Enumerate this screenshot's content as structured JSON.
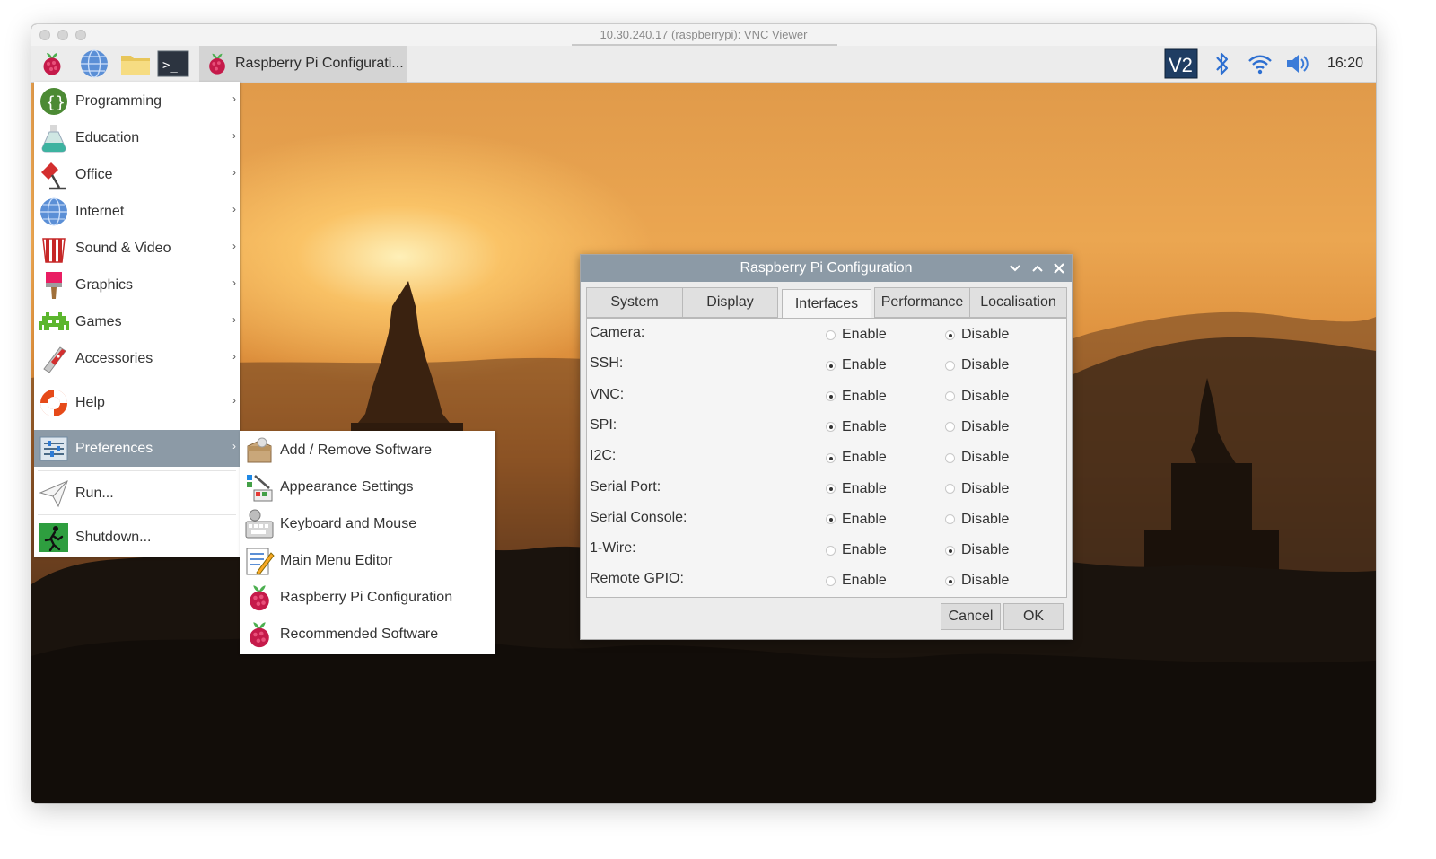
{
  "vnc_window": {
    "title": "10.30.240.17 (raspberrypi): VNC Viewer"
  },
  "taskbar": {
    "launchers": [
      {
        "icon": "raspberry-icon"
      },
      {
        "icon": "globe-icon"
      },
      {
        "icon": "folder-icon"
      },
      {
        "icon": "terminal-icon",
        "text": ">_"
      }
    ],
    "task": {
      "icon": "raspberry-icon",
      "label": "Raspberry Pi Configurati..."
    },
    "tray": {
      "vnc_icon_text": "V2",
      "clock": "16:20"
    }
  },
  "main_menu": {
    "items": [
      {
        "label": "Programming",
        "icon": "programming-icon",
        "submenu": true
      },
      {
        "label": "Education",
        "icon": "education-flask-icon",
        "submenu": true
      },
      {
        "label": "Office",
        "icon": "office-icon",
        "submenu": true
      },
      {
        "label": "Internet",
        "icon": "globe-icon",
        "submenu": true
      },
      {
        "label": "Sound & Video",
        "icon": "popcorn-icon",
        "submenu": true
      },
      {
        "label": "Graphics",
        "icon": "paintbrush-icon",
        "submenu": true
      },
      {
        "label": "Games",
        "icon": "invader-icon",
        "submenu": true
      },
      {
        "label": "Accessories",
        "icon": "knife-icon",
        "submenu": true
      },
      {
        "label": "Help",
        "icon": "lifebuoy-icon",
        "submenu": true
      },
      {
        "label": "Preferences",
        "icon": "sliders-icon",
        "submenu": true,
        "selected": true
      },
      {
        "label": "Run...",
        "icon": "paper-plane-icon",
        "submenu": false
      },
      {
        "label": "Shutdown...",
        "icon": "exit-icon",
        "submenu": false
      }
    ],
    "arrow": "›"
  },
  "preferences_submenu": {
    "items": [
      {
        "label": "Add / Remove Software",
        "icon": "package-icon"
      },
      {
        "label": "Appearance Settings",
        "icon": "appearance-icon"
      },
      {
        "label": "Keyboard and Mouse",
        "icon": "keyboard-icon"
      },
      {
        "label": "Main Menu Editor",
        "icon": "menu-editor-icon"
      },
      {
        "label": "Raspberry Pi Configuration",
        "icon": "raspberry-icon"
      },
      {
        "label": "Recommended Software",
        "icon": "raspberry-icon"
      }
    ]
  },
  "dialog": {
    "title": "Raspberry Pi Configuration",
    "tabs": [
      {
        "label": "System",
        "active": false
      },
      {
        "label": "Display",
        "active": false
      },
      {
        "label": "Interfaces",
        "active": true
      },
      {
        "label": "Performance",
        "active": false
      },
      {
        "label": "Localisation",
        "active": false
      }
    ],
    "enable_label": "Enable",
    "disable_label": "Disable",
    "interfaces": [
      {
        "label": "Camera:",
        "value": "Disable"
      },
      {
        "label": "SSH:",
        "value": "Enable"
      },
      {
        "label": "VNC:",
        "value": "Enable"
      },
      {
        "label": "SPI:",
        "value": "Enable"
      },
      {
        "label": "I2C:",
        "value": "Enable"
      },
      {
        "label": "Serial Port:",
        "value": "Enable"
      },
      {
        "label": "Serial Console:",
        "value": "Enable"
      },
      {
        "label": "1-Wire:",
        "value": "Disable"
      },
      {
        "label": "Remote GPIO:",
        "value": "Disable"
      }
    ],
    "buttons": {
      "cancel": "Cancel",
      "ok": "OK"
    }
  }
}
